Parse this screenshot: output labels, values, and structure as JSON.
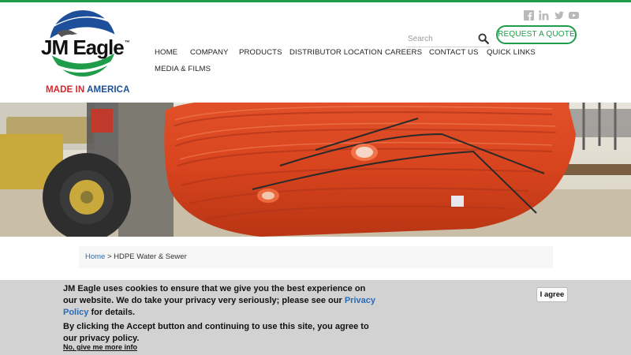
{
  "brand": {
    "logo_name": "JM Eagle",
    "logo_trademark": "™",
    "tagline_red": "MADE IN ",
    "tagline_blue": "AMERICA",
    "colors": {
      "green": "#1f9d4a",
      "blue": "#1d4f9a",
      "red": "#d7262e"
    }
  },
  "social": [
    "facebook-icon",
    "linkedin-icon",
    "twitter-icon",
    "youtube-icon"
  ],
  "search": {
    "placeholder": "Search",
    "value": ""
  },
  "header": {
    "quote_label": "REQUEST A QUOTE"
  },
  "nav": {
    "items": [
      {
        "label": "HOME"
      },
      {
        "label": "COMPANY"
      },
      {
        "label": "PRODUCTS"
      },
      {
        "label": "DISTRIBUTOR LOCATION"
      },
      {
        "label": "CAREERS"
      },
      {
        "label": "CONTACT US"
      },
      {
        "label": "QUICK LINKS"
      },
      {
        "label": "MEDIA & FILMS"
      }
    ]
  },
  "breadcrumb": {
    "home": "Home",
    "separator": " > ",
    "current": "HDPE Water & Sewer"
  },
  "cookie": {
    "text_before_link": "JM Eagle uses cookies to ensure that we give you the best experience on our website. We do take your privacy very seriously; please see our ",
    "policy_link": "Privacy Policy",
    "text_after_link": " for details.",
    "paragraph2": "By clicking the Accept button and continuing to use this site, you agree to our privacy policy.",
    "more_info": "No, give me more info",
    "agree": "I agree"
  }
}
